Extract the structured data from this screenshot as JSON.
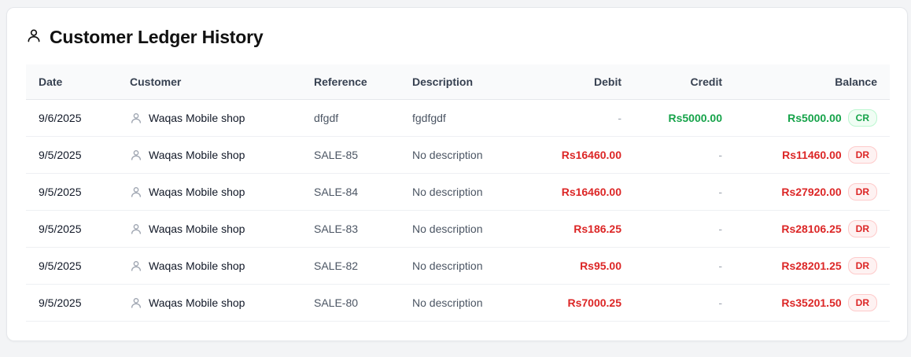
{
  "page": {
    "title": "Customer Ledger History",
    "title_icon": "user-icon"
  },
  "colors": {
    "debit": "#dc2626",
    "credit": "#16a34a",
    "header_bg": "#f9fafb"
  },
  "table": {
    "columns": {
      "date": "Date",
      "customer": "Customer",
      "reference": "Reference",
      "description": "Description",
      "debit": "Debit",
      "credit": "Credit",
      "balance": "Balance"
    },
    "rows": [
      {
        "date": "9/6/2025",
        "customer": "Waqas Mobile shop",
        "reference": "dfgdf",
        "description": "fgdfgdf",
        "debit": "-",
        "credit": "Rs5000.00",
        "balance": "Rs5000.00",
        "balance_type": "CR"
      },
      {
        "date": "9/5/2025",
        "customer": "Waqas Mobile shop",
        "reference": "SALE-85",
        "description": "No description",
        "debit": "Rs16460.00",
        "credit": "-",
        "balance": "Rs11460.00",
        "balance_type": "DR"
      },
      {
        "date": "9/5/2025",
        "customer": "Waqas Mobile shop",
        "reference": "SALE-84",
        "description": "No description",
        "debit": "Rs16460.00",
        "credit": "-",
        "balance": "Rs27920.00",
        "balance_type": "DR"
      },
      {
        "date": "9/5/2025",
        "customer": "Waqas Mobile shop",
        "reference": "SALE-83",
        "description": "No description",
        "debit": "Rs186.25",
        "credit": "-",
        "balance": "Rs28106.25",
        "balance_type": "DR"
      },
      {
        "date": "9/5/2025",
        "customer": "Waqas Mobile shop",
        "reference": "SALE-82",
        "description": "No description",
        "debit": "Rs95.00",
        "credit": "-",
        "balance": "Rs28201.25",
        "balance_type": "DR"
      },
      {
        "date": "9/5/2025",
        "customer": "Waqas Mobile shop",
        "reference": "SALE-80",
        "description": "No description",
        "debit": "Rs7000.25",
        "credit": "-",
        "balance": "Rs35201.50",
        "balance_type": "DR"
      }
    ]
  }
}
